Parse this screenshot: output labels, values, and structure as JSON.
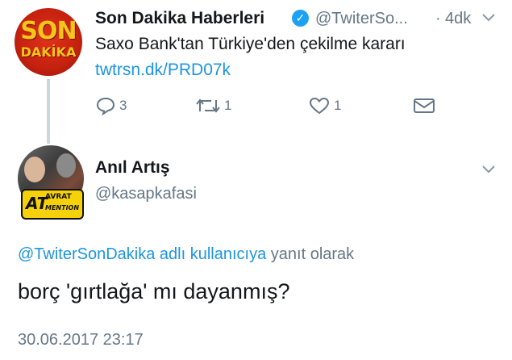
{
  "tweet1": {
    "avatar_logo_line1": "SON",
    "avatar_logo_line2": "DAKİKA",
    "author_name": "Son Dakika Haberleri",
    "handle": "@TwiterSo...",
    "separator": "·",
    "time": "4dk",
    "text": "Saxo Bank'tan  Türkiye'den çekilme kararı",
    "link": "twtrsn.dk/PRD07k",
    "reply_count": "3",
    "retweet_count": "1",
    "like_count": "1",
    "icons": [
      "reply-icon",
      "retweet-icon",
      "like-icon",
      "dm-icon",
      "verified-icon",
      "chevron-down-icon"
    ]
  },
  "tweet2": {
    "author_name": "Anıl Artış",
    "handle": "@kasapkafasi",
    "badge_main": "AT",
    "badge_top": "AVRAT",
    "badge_bottom": "MENTION",
    "reply_prefix": "@TwiterSonDakika adlı kullanıcıya",
    "reply_suffix": "yanıt olarak",
    "text": "borç 'gırtlağa' mı dayanmış?",
    "date": "30.06.2017 23:17"
  },
  "colors": {
    "link": "#1b95e0",
    "secondary_text": "#657786",
    "verified": "#1da1f2",
    "thread_line": "#ccd6dd"
  }
}
